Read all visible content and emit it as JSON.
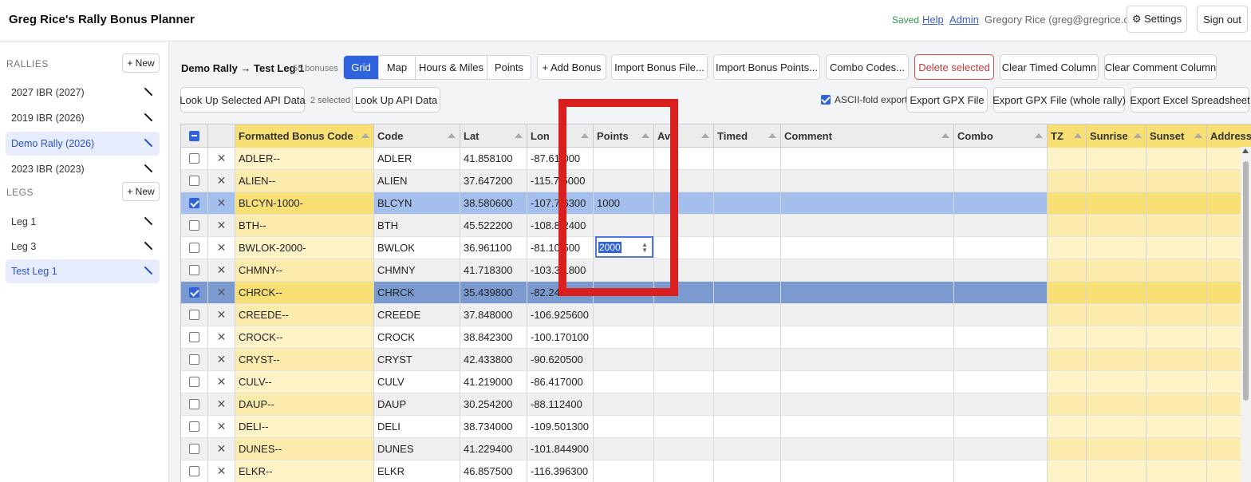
{
  "header": {
    "title": "Greg Rice's Rally Bonus Planner",
    "saved": "Saved",
    "help": "Help",
    "admin": "Admin",
    "user": "Gregory Rice (greg@gregrice.com)",
    "settings": "⚙ Settings",
    "signout": "Sign out"
  },
  "sidebar": {
    "rallies_heading": "RALLIES",
    "legs_heading": "LEGS",
    "new_label": "+ New",
    "rallies": [
      {
        "label": "2027 IBR (2027)"
      },
      {
        "label": "2019 IBR (2026)"
      },
      {
        "label": "Demo Rally (2026)",
        "active": true
      },
      {
        "label": "2023 IBR (2023)"
      }
    ],
    "legs": [
      {
        "label": "Leg 1"
      },
      {
        "label": "Leg 3"
      },
      {
        "label": "Test Leg 1",
        "active": true
      }
    ]
  },
  "toolbar": {
    "breadcrumb": "Demo Rally → Test Leg 1",
    "bonus_count": "55 bonuses",
    "views": [
      "Grid",
      "Map",
      "Hours & Miles",
      "Points"
    ],
    "active_view": "Grid",
    "add_bonus": "+ Add Bonus",
    "import_file": "Import Bonus File...",
    "import_points": "Import Bonus Points...",
    "combo_codes": "Combo Codes...",
    "delete_selected": "Delete selected",
    "clear_timed": "Clear Timed Column",
    "clear_comment": "Clear Comment Column",
    "lookup_selected": "Look Up Selected API Data",
    "selected_count": "2 selected",
    "lookup_api": "Look Up API Data",
    "ascii_fold": "ASCII-fold export",
    "export_gpx": "Export GPX File",
    "export_gpx_whole": "Export GPX File (whole rally)",
    "export_excel": "Export Excel Spreadsheet"
  },
  "grid": {
    "columns": [
      "Formatted Bonus Code",
      "Code",
      "Lat",
      "Lon",
      "Points",
      "Ava",
      "Timed",
      "Comment",
      "Combo",
      "TZ",
      "Sunrise",
      "Sunset",
      "Address"
    ],
    "editor_value": "2000",
    "rows": [
      {
        "fmt": "ADLER--",
        "code": "ADLER",
        "lat": "41.858100",
        "lon": "-87.61  000",
        "points": "",
        "sel": false
      },
      {
        "fmt": "ALIEN--",
        "code": "ALIEN",
        "lat": "37.647200",
        "lon": "-115.7  5000",
        "points": "",
        "sel": false
      },
      {
        "fmt": "BLCYN-1000-",
        "code": "BLCYN",
        "lat": "38.580600",
        "lon": "-107.7  6300",
        "points": "1000",
        "sel": true
      },
      {
        "fmt": "BTH--",
        "code": "BTH",
        "lat": "45.522200",
        "lon": "-108.8  2400",
        "points": "",
        "sel": false
      },
      {
        "fmt": "BWLOK-2000-",
        "code": "BWLOK",
        "lat": "36.961100",
        "lon": "-81.10  500",
        "points": "",
        "sel": false
      },
      {
        "fmt": "CHMNY--",
        "code": "CHMNY",
        "lat": "41.718300",
        "lon": "-103.3  1800",
        "points": "",
        "sel": false
      },
      {
        "fmt": "CHRCK--",
        "code": "CHRCK",
        "lat": "35.439800",
        "lon": "-82.24  00",
        "points": "",
        "sel": true
      },
      {
        "fmt": "CREEDE--",
        "code": "CREEDE",
        "lat": "37.848000",
        "lon": "-106.925600",
        "points": "",
        "sel": false
      },
      {
        "fmt": "CROCK--",
        "code": "CROCK",
        "lat": "38.842300",
        "lon": "-100.170100",
        "points": "",
        "sel": false
      },
      {
        "fmt": "CRYST--",
        "code": "CRYST",
        "lat": "42.433800",
        "lon": "-90.620500",
        "points": "",
        "sel": false
      },
      {
        "fmt": "CULV--",
        "code": "CULV",
        "lat": "41.219000",
        "lon": "-86.417000",
        "points": "",
        "sel": false
      },
      {
        "fmt": "DAUP--",
        "code": "DAUP",
        "lat": "30.254200",
        "lon": "-88.112400",
        "points": "",
        "sel": false
      },
      {
        "fmt": "DELI--",
        "code": "DELI",
        "lat": "38.734000",
        "lon": "-109.501300",
        "points": "",
        "sel": false
      },
      {
        "fmt": "DUNES--",
        "code": "DUNES",
        "lat": "41.229400",
        "lon": "-101.844900",
        "points": "",
        "sel": false
      },
      {
        "fmt": "ELKR--",
        "code": "ELKR",
        "lat": "46.857500",
        "lon": "-116.396300",
        "points": "",
        "sel": false
      }
    ]
  }
}
